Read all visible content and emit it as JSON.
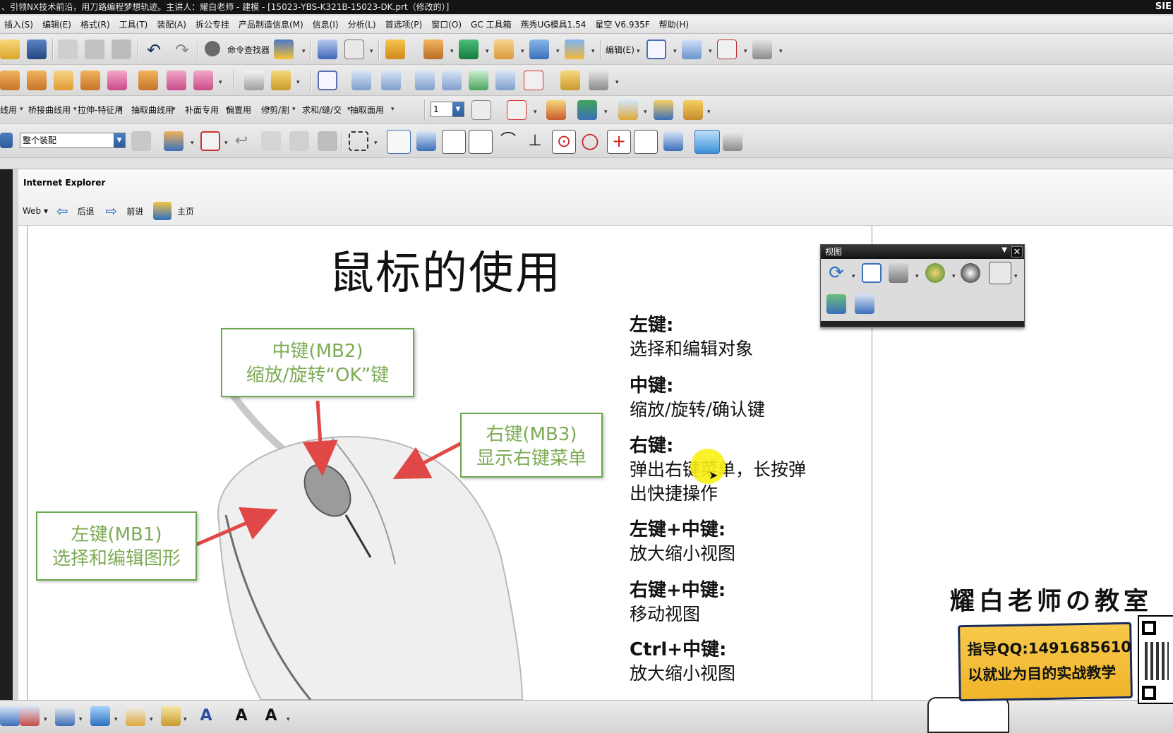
{
  "window": {
    "title": "、引领NX技术前沿，用刀路编程梦想轨迹。主讲人：耀白老师 - 建模 - [15023-YBS-K321B-15023-DK.prt（修改的）]",
    "brand": "SIE"
  },
  "menu": {
    "items": [
      "插入(S)",
      "编辑(E)",
      "格式(R)",
      "工具(T)",
      "装配(A)",
      "拆公专挂",
      "产品制造信息(M)",
      "信息(I)",
      "分析(L)",
      "首选项(P)",
      "窗口(O)",
      "GC 工具箱",
      "燕秀UG模具1.54",
      "星空 V6.935F",
      "帮助(H)"
    ]
  },
  "toolbar1": {
    "command_finder": "命令查找器",
    "edit_label": "编辑(E)"
  },
  "toolbar3": {
    "labels": [
      "线用",
      "桥接曲线用",
      "拉伸-特征用",
      "抽取曲线用",
      "补面专用",
      "偏置用",
      "修剪/割",
      "求和/缝/交",
      "抽取面用"
    ],
    "layer_value": "1"
  },
  "toolbar4": {
    "filter_value": "整个装配"
  },
  "ie": {
    "title": "Internet Explorer",
    "web": "Web",
    "back": "后退",
    "forward": "前进",
    "home": "主页"
  },
  "slide": {
    "title": "鼠标的使用",
    "callout_mb2_line1": "中键(MB2)",
    "callout_mb2_line2": "缩放/旋转“OK”键",
    "callout_mb3_line1": "右键(MB3)",
    "callout_mb3_line2": "显示右键菜单",
    "callout_mb1_line1": "左键(MB1)",
    "callout_mb1_line2": "选择和编辑图形",
    "desc": [
      {
        "head": "左键:",
        "body1": "选择和编辑对象",
        "body2": ""
      },
      {
        "head": "中键:",
        "body1": "缩放/旋转/确认键",
        "body2": ""
      },
      {
        "head": "右键:",
        "body1": "弹出右键菜单，长按弹",
        "body2": "出快捷操作"
      },
      {
        "head": "左键+中键:",
        "body1": "放大缩小视图",
        "body2": ""
      },
      {
        "head": "右键+中键:",
        "body1": "移动视图",
        "body2": ""
      },
      {
        "head": "Ctrl+中键:",
        "body1": "放大缩小视图",
        "body2": ""
      }
    ]
  },
  "view_dialog": {
    "title": "视图"
  },
  "watermark": {
    "title": "耀白老师の教室",
    "line1": "指导QQ:1491685610",
    "line2": "以就业为目的实战教学"
  },
  "colors": {
    "callout_border": "#6aa84f",
    "callout_text": "#7dab55",
    "arrow": "#e04848",
    "card": "#f0b52a"
  }
}
